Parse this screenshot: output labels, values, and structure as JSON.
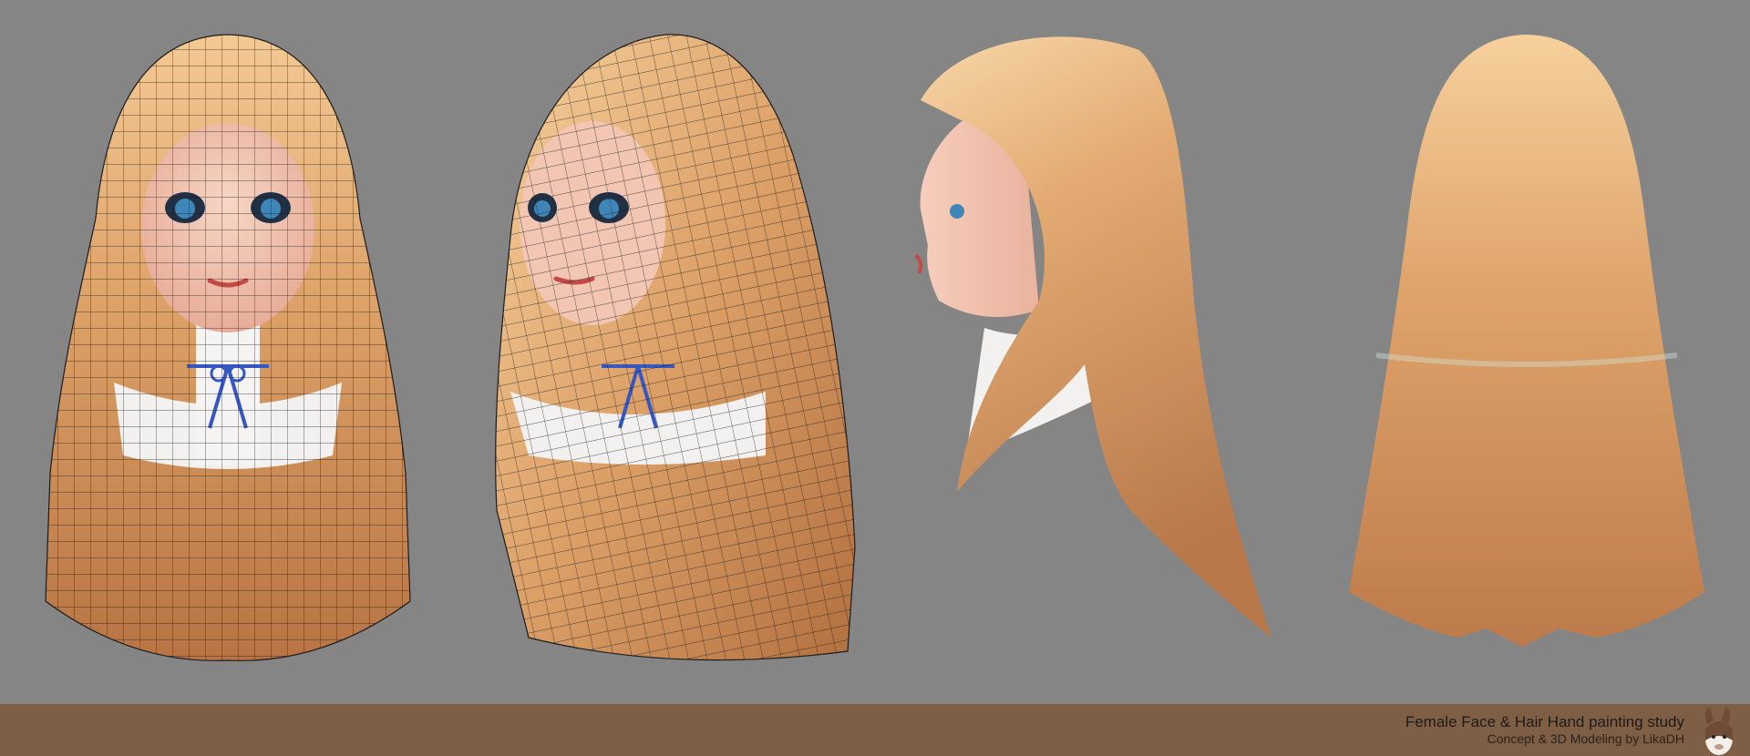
{
  "canvas": {
    "background": "#858585"
  },
  "colors": {
    "hair_light": "#f2c48c",
    "hair_mid": "#d9985e",
    "hair_dark": "#a8683c",
    "skin": "#f2c6b2",
    "collar": "#f3f1ef",
    "ribbon": "#3657c2",
    "eye": "#3f86b8",
    "wire": "#1c1c1c",
    "footer": "#7e5e45"
  },
  "views": [
    {
      "name": "front-wireframe",
      "wireframe": true
    },
    {
      "name": "three-quarter-wireframe",
      "wireframe": true
    },
    {
      "name": "side-profile",
      "wireframe": false
    },
    {
      "name": "back-view",
      "wireframe": false
    }
  ],
  "footer": {
    "title": "Female Face & Hair Hand painting study",
    "credit": "Concept & 3D Modeling by LikaDH",
    "logo_icon": "llama-head-icon"
  }
}
